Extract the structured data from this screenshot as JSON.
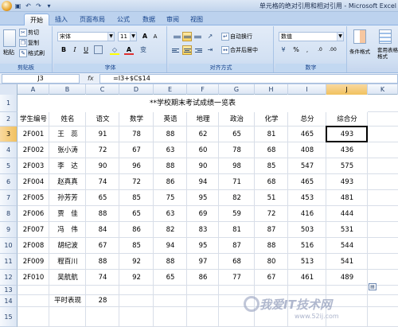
{
  "window": {
    "title": "单元格的绝对引用和相对引用 - Microsoft Excel"
  },
  "tabs": [
    "开始",
    "插入",
    "页面布局",
    "公式",
    "数据",
    "审阅",
    "视图"
  ],
  "ribbon": {
    "clipboard": {
      "group": "剪贴板",
      "paste": "粘贴",
      "cut": "剪切",
      "copy": "复制",
      "format_painter": "格式刷"
    },
    "font": {
      "group": "字体",
      "name": "宋体",
      "size": "11"
    },
    "alignment": {
      "group": "对齐方式",
      "wrap": "自动换行",
      "merge": "合并后居中"
    },
    "number": {
      "group": "数字",
      "format": "数值"
    },
    "styles": {
      "conditional": "条件格式",
      "table": "套用表格格式"
    }
  },
  "formula_bar": {
    "name_box": "J3",
    "fx": "fx",
    "formula": "=I3+$C$14"
  },
  "columns": [
    "A",
    "B",
    "C",
    "D",
    "E",
    "F",
    "G",
    "H",
    "I",
    "J",
    "K"
  ],
  "rows": [
    "1",
    "2",
    "3",
    "4",
    "5",
    "6",
    "7",
    "8",
    "9",
    "10",
    "11",
    "12",
    "13",
    "14",
    "15"
  ],
  "sheet": {
    "title": "**学校期末考试成绩一览表",
    "headers": [
      "学生编号",
      "姓名",
      "语文",
      "数学",
      "英语",
      "地理",
      "政治",
      "化学",
      "总分",
      "综合分"
    ],
    "data": [
      [
        "2F001",
        "王　蕊",
        "91",
        "78",
        "88",
        "62",
        "65",
        "81",
        "465",
        "493"
      ],
      [
        "2F002",
        "张小涛",
        "72",
        "67",
        "63",
        "60",
        "78",
        "68",
        "408",
        "436"
      ],
      [
        "2F003",
        "李　达",
        "90",
        "96",
        "88",
        "90",
        "98",
        "85",
        "547",
        "575"
      ],
      [
        "2F004",
        "赵真真",
        "74",
        "72",
        "86",
        "94",
        "71",
        "68",
        "465",
        "493"
      ],
      [
        "2F005",
        "孙芳芳",
        "65",
        "85",
        "75",
        "95",
        "82",
        "51",
        "453",
        "481"
      ],
      [
        "2F006",
        "贾　佳",
        "88",
        "65",
        "63",
        "69",
        "59",
        "72",
        "416",
        "444"
      ],
      [
        "2F007",
        "冯　伟",
        "84",
        "86",
        "82",
        "83",
        "81",
        "87",
        "503",
        "531"
      ],
      [
        "2F008",
        "胡纪波",
        "67",
        "85",
        "94",
        "95",
        "87",
        "88",
        "516",
        "544"
      ],
      [
        "2F009",
        "程百川",
        "88",
        "92",
        "88",
        "97",
        "68",
        "80",
        "513",
        "541"
      ],
      [
        "2F010",
        "吴航航",
        "74",
        "92",
        "65",
        "86",
        "77",
        "67",
        "461",
        "489"
      ]
    ],
    "average_label": "平时表现",
    "average_value": "28"
  },
  "watermark": {
    "text": "我爱IT技术网",
    "url": "www.52ij.com"
  }
}
